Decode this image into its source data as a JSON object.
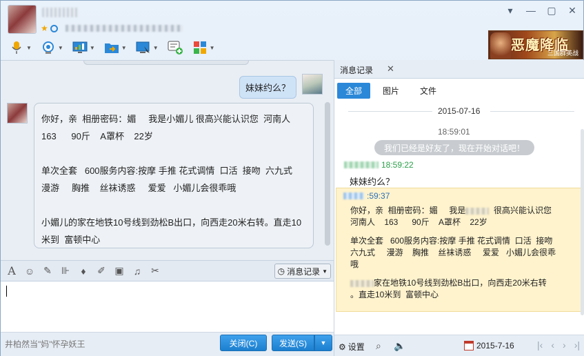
{
  "header": {
    "window_controls": {
      "menu": "▾",
      "minimize": "—",
      "maximize": "▢",
      "close": "✕"
    },
    "toolbar_icons": [
      "microphone-icon",
      "video-camera-icon",
      "screen-share-icon",
      "file-transfer-icon",
      "remote-desktop-icon",
      "invite-icon",
      "apps-icon"
    ],
    "game_banner": {
      "title": "恶魔降临",
      "subtitle": "三国群英战"
    }
  },
  "chat": {
    "outgoing": {
      "text": "妹妹约么？"
    },
    "incoming": {
      "paragraphs": [
        "你好，亲  相册密码：媚     我是小媚儿 很高兴能认识您  河南人\n163      90斤    A罩杯    22岁",
        "单次全套   600服务内容:按摩 手推 花式调情  口活  接吻  六九式\n漫游     胸推    丝袜诱惑     爱爱   小媚儿会很乖哦",
        "小媚儿的家在地铁10号线到劲松B出口，向西走20米右转。直走10\n米到  富顿中心"
      ]
    }
  },
  "input": {
    "history_button": "消息记录",
    "ad_text": "井柏然当\"妈\"怀孕妖王",
    "close_button": "关闭(C)",
    "send_button": "发送(S)"
  },
  "history": {
    "tab_title": "消息记录",
    "filters": [
      "全部",
      "图片",
      "文件"
    ],
    "date": "2015-07-16",
    "time": "18:59:01",
    "system_message": "我们已经是好友了，现在开始对话吧！",
    "msg1": {
      "time": "18:59:22",
      "text": "妹妹约么？"
    },
    "msg2": {
      "time": ":59:37",
      "para1_a": "你好，亲  相册密码：媚     我是",
      "para1_b": "  很高兴能认识您\n河南人    163      90斤    A罩杯    22岁",
      "para2": "单次全套   600服务内容:按摩 手推 花式调情  口活  接吻\n六九式     漫游    胸推    丝袜诱惑     爱爱   小媚儿会很乖\n哦",
      "para3_b": "家在地铁10号线到劲松B出口，向西走20米右转\n。直走10米到  富顿中心"
    },
    "footer": {
      "settings": "设置",
      "date": "2015-7-16",
      "pager": [
        "|‹",
        "‹",
        "›",
        "›|"
      ]
    }
  }
}
